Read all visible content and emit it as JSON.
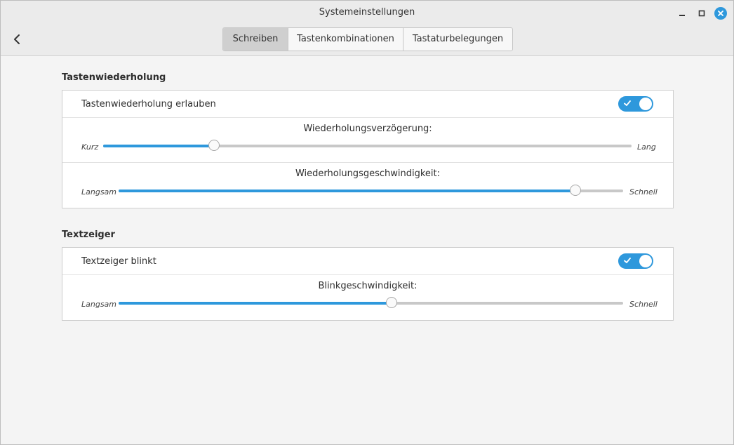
{
  "window": {
    "title": "Systemeinstellungen",
    "buttons": [
      "minimize-icon",
      "maximize-icon",
      "close-icon"
    ]
  },
  "tabs": [
    {
      "label": "Schreiben",
      "active": true
    },
    {
      "label": "Tastenkombinationen",
      "active": false
    },
    {
      "label": "Tastaturbelegungen",
      "active": false
    }
  ],
  "repeat": {
    "heading": "Tastenwiederholung",
    "allow_label": "Tastenwiederholung erlauben",
    "allow_enabled": true,
    "delay": {
      "caption": "Wiederholungsverzögerung:",
      "min_label": "Kurz",
      "max_label": "Lang",
      "value": 0.21
    },
    "speed": {
      "caption": "Wiederholungsgeschwindigkeit:",
      "min_label": "Langsam",
      "max_label": "Schnell",
      "value": 0.906
    }
  },
  "cursor": {
    "heading": "Textzeiger",
    "blink_label": "Textzeiger blinkt",
    "blink_enabled": true,
    "blink_speed": {
      "caption": "Blinkgeschwindigkeit:",
      "min_label": "Langsam",
      "max_label": "Schnell",
      "value": 0.541
    }
  },
  "colors": {
    "accent": "#2e98dc",
    "track": "#c8c8c8"
  }
}
